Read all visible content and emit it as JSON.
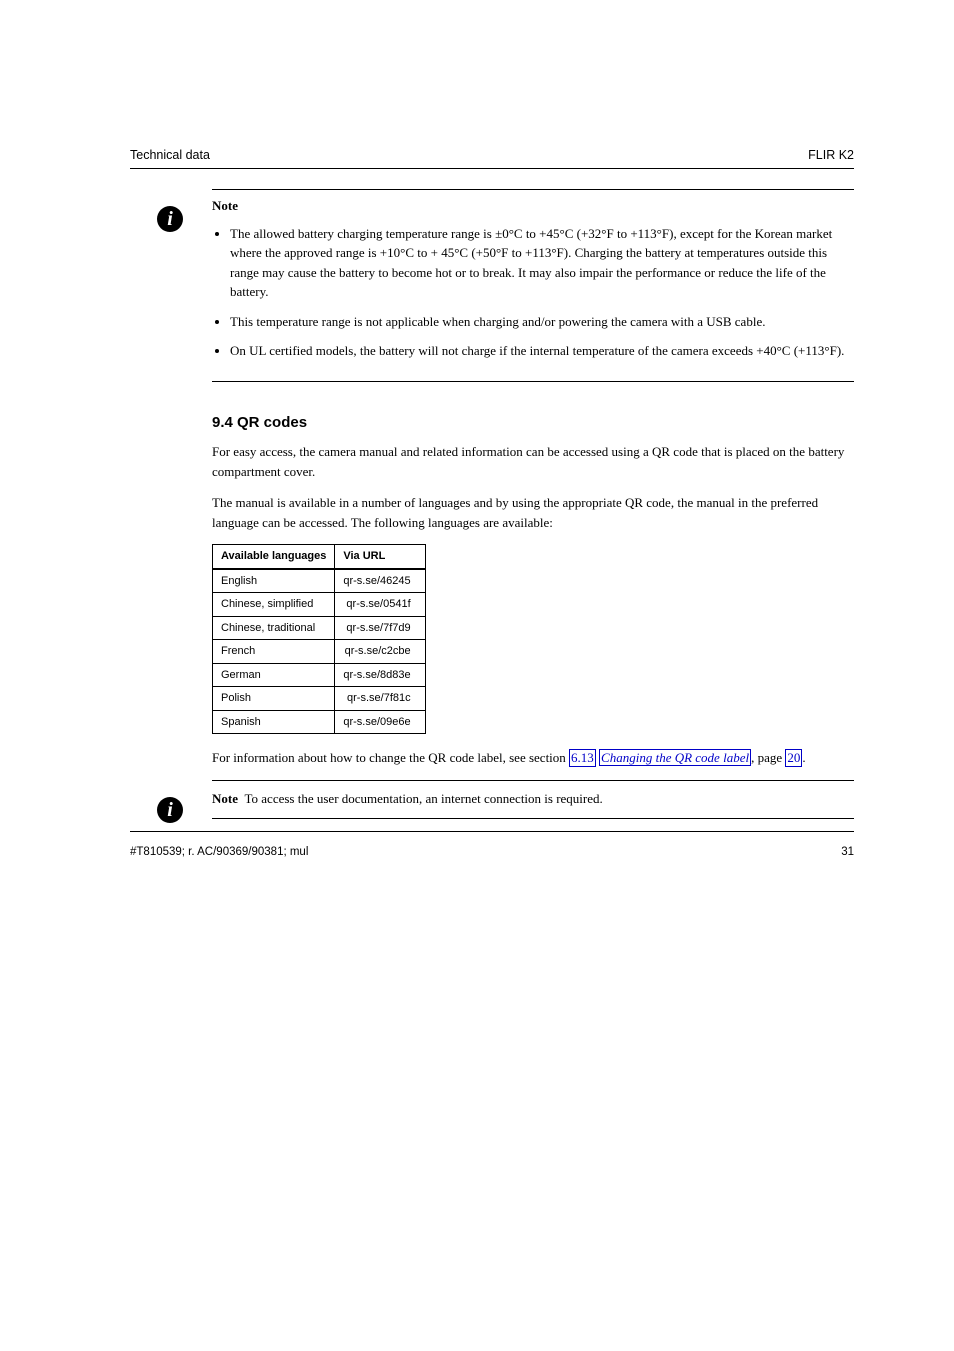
{
  "header": {
    "left": "Technical data",
    "right": "FLIR K2"
  },
  "note1": {
    "label": "Note",
    "items": [
      "The allowed battery charging temperature range is ±0°C to +45°C (+32°F to +113°F), except for the Korean market where the approved range is +10°C to + 45°C (+50°F to +113°F). Charging the battery at temperatures outside this range may cause the battery to become hot or to break. It may also impair the performance or reduce the life of the battery.",
      "This temperature range is not applicable when charging and/or powering the camera with a USB cable.",
      "On UL certified models, the battery will not charge if the internal temperature of the camera exceeds +40°C (+113°F)."
    ]
  },
  "section": {
    "title": "9.4 QR codes",
    "intro": "For easy access, the camera manual and related information can be accessed using a QR code that is placed on the battery compartment cover.",
    "body": "The manual is available in a number of languages and by using the appropriate QR code, the manual in the preferred language can be accessed. The following languages are available:",
    "table": {
      "headers": [
        "Available languages",
        "Via URL"
      ],
      "rows": [
        [
          "English",
          "qr-s.se/46245"
        ],
        [
          "Chinese, simplified",
          "qr-s.se/0541f"
        ],
        [
          "Chinese, traditional",
          "qr-s.se/7f7d9"
        ],
        [
          "French",
          "qr-s.se/c2cbe"
        ],
        [
          "German",
          "qr-s.se/8d83e"
        ],
        [
          "Polish",
          "qr-s.se/7f81c"
        ],
        [
          "Spanish",
          "qr-s.se/09e6e"
        ]
      ]
    },
    "afterTable": {
      "prefix": "For information about how to change the QR code label, see section ",
      "linkRef": "6.13",
      "linkText": "Changing the QR code label",
      "page": ", page ",
      "pageNum": "20",
      "suffix": "."
    }
  },
  "note2": {
    "label": "Note",
    "text": "To access the user documentation, an internet connection is required."
  },
  "footer": {
    "left": "#T810539; r. AC/90369/90381; mul",
    "right": "31"
  }
}
